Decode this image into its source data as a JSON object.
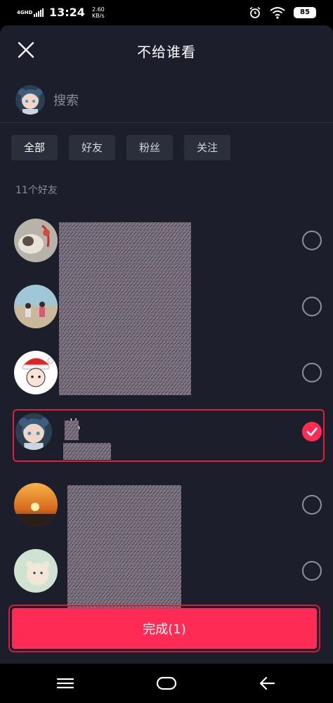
{
  "status_bar": {
    "network": "4GHD",
    "time": "13:24",
    "speed_value": "2.60",
    "speed_unit": "KB/s",
    "battery": "85",
    "icons": [
      "signal-icon",
      "alarm-icon",
      "wifi-icon",
      "battery-icon"
    ]
  },
  "header": {
    "title": "不给谁看",
    "close_icon": "close-icon"
  },
  "search": {
    "placeholder": "搜索"
  },
  "tabs": [
    {
      "label": "全部",
      "active": true
    },
    {
      "label": "好友",
      "active": false
    },
    {
      "label": "粉丝",
      "active": false
    },
    {
      "label": "关注",
      "active": false
    }
  ],
  "friend_count": "11个好友",
  "friends": [
    {
      "name": "",
      "selected": false,
      "avatar": "cat-avatar"
    },
    {
      "name": "",
      "selected": false,
      "avatar": "kids-beach-avatar"
    },
    {
      "name": "",
      "selected": false,
      "avatar": "cartoon-santa-hat-avatar"
    },
    {
      "name": "儿",
      "selected": true,
      "avatar": "anime-girl-avatar"
    },
    {
      "name": "",
      "selected": false,
      "avatar": "sunset-avatar"
    },
    {
      "name": "",
      "selected": false,
      "avatar": "bear-sticker-avatar"
    }
  ],
  "done_button": {
    "label": "完成(1)"
  },
  "colors": {
    "accent": "#fe2c55",
    "panel": "#1c1e2c",
    "tab_bg": "#2b2e3b",
    "highlight_border": "#e21f3b"
  },
  "nav_bar": {
    "icons": [
      "menu-icon",
      "home-icon",
      "back-icon"
    ]
  }
}
